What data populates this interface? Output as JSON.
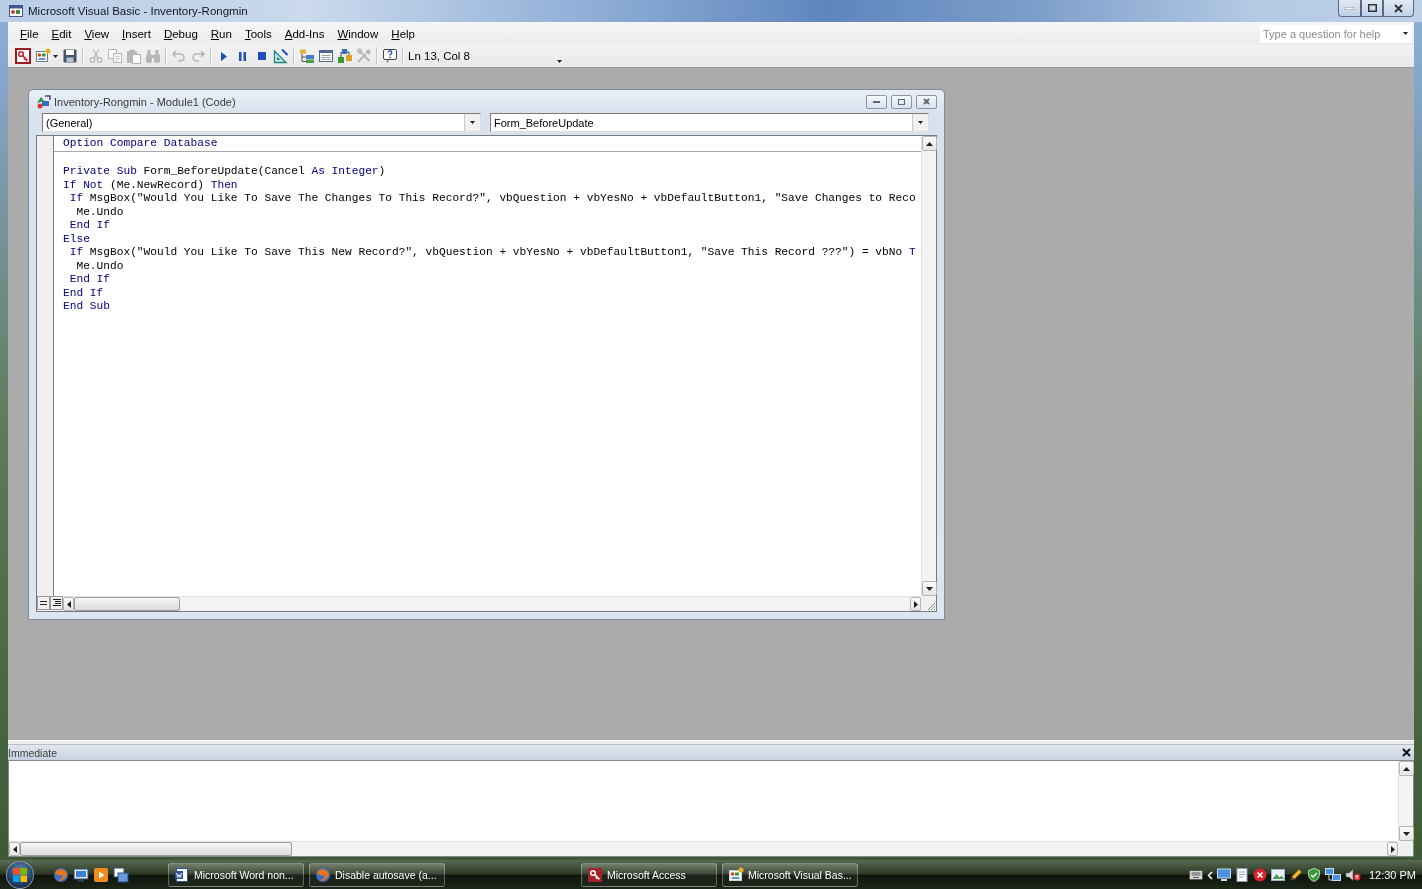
{
  "window": {
    "title": "Microsoft Visual Basic - Inventory-Rongmin"
  },
  "menu": [
    "File",
    "Edit",
    "View",
    "Insert",
    "Debug",
    "Run",
    "Tools",
    "Add-Ins",
    "Window",
    "Help"
  ],
  "help_box": {
    "placeholder": "Type a question for help"
  },
  "toolbar": {
    "groups": [
      {
        "buttons": [
          {
            "kind": "access",
            "disabled": false
          },
          {
            "kind": "insert",
            "disabled": false
          },
          {
            "kind": "save",
            "disabled": false
          }
        ]
      },
      {
        "buttons": [
          {
            "kind": "cut",
            "disabled": true
          },
          {
            "kind": "copy",
            "disabled": true
          },
          {
            "kind": "paste",
            "disabled": true
          },
          {
            "kind": "find",
            "disabled": true
          }
        ]
      },
      {
        "buttons": [
          {
            "kind": "undo",
            "disabled": true
          },
          {
            "kind": "redo",
            "disabled": true
          }
        ]
      },
      {
        "buttons": [
          {
            "kind": "run",
            "disabled": false
          },
          {
            "kind": "break",
            "disabled": false
          },
          {
            "kind": "reset",
            "disabled": false
          },
          {
            "kind": "design",
            "disabled": false
          }
        ]
      },
      {
        "buttons": [
          {
            "kind": "project",
            "disabled": false
          },
          {
            "kind": "properties",
            "disabled": false
          },
          {
            "kind": "browser",
            "disabled": false
          },
          {
            "kind": "toolbox",
            "disabled": true
          }
        ]
      },
      {
        "buttons": [
          {
            "kind": "help",
            "disabled": false
          }
        ]
      }
    ],
    "position": "Ln 13, Col 8"
  },
  "code_window": {
    "title": "Inventory-Rongmin - Module1 (Code)",
    "object_box": {
      "value": "(General)"
    },
    "procedure_box": {
      "value": "Form_BeforeUpdate"
    },
    "sections": [
      {
        "lines": [
          [
            {
              "kind": "keyword",
              "text": "Option Compare Database"
            }
          ]
        ]
      },
      {
        "lines": [
          [
            {
              "kind": "keyword",
              "text": "Private Sub"
            },
            {
              "kind": "text",
              "text": " Form_BeforeUpdate(Cancel "
            },
            {
              "kind": "keyword",
              "text": "As Integer"
            },
            {
              "kind": "text",
              "text": ")"
            }
          ],
          [
            {
              "kind": "keyword",
              "text": "If Not"
            },
            {
              "kind": "text",
              "text": " (Me.NewRecord) "
            },
            {
              "kind": "keyword",
              "text": "Then"
            }
          ],
          [
            {
              "kind": "keyword",
              "text": " If"
            },
            {
              "kind": "text",
              "text": " MsgBox(\"Would You Like To Save The Changes To This Record?\", vbQuestion + vbYesNo + vbDefaultButton1, \"Save Changes to Reco"
            }
          ],
          [
            {
              "kind": "text",
              "text": "  Me.Undo"
            }
          ],
          [
            {
              "kind": "keyword",
              "text": " End If"
            }
          ],
          [
            {
              "kind": "keyword",
              "text": "Else"
            }
          ],
          [
            {
              "kind": "keyword",
              "text": " If"
            },
            {
              "kind": "text",
              "text": " MsgBox(\"Would You Like To Save This New Record?\", vbQuestion + vbYesNo + vbDefaultButton1, \"Save This Record ???\") = vbNo "
            },
            {
              "kind": "keyword",
              "text": "T"
            }
          ],
          [
            {
              "kind": "text",
              "text": "  Me.Undo"
            }
          ],
          [
            {
              "kind": "keyword",
              "text": " End If"
            }
          ],
          [
            {
              "kind": "keyword",
              "text": "End If"
            }
          ],
          [
            {
              "kind": "keyword",
              "text": "End Sub"
            }
          ]
        ]
      }
    ]
  },
  "immediate": {
    "title": "Immediate"
  },
  "taskbar": {
    "tasks": [
      {
        "label": "Microsoft Word non...",
        "kind": "document"
      },
      {
        "label": "Disable autosave (a...",
        "kind": "browser"
      },
      {
        "label": "Microsoft Access",
        "kind": "database"
      },
      {
        "label": "Microsoft Visual Bas...",
        "kind": "editor"
      }
    ],
    "clock": "12:30 PM"
  }
}
